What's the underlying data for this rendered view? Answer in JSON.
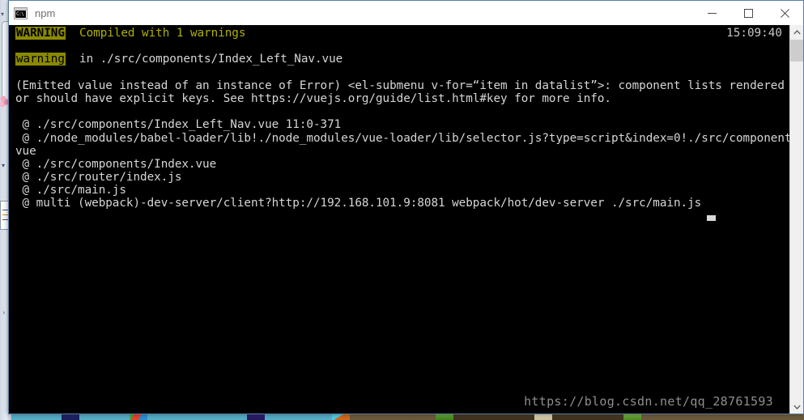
{
  "window": {
    "title": "npm",
    "icon_name": "cmd-console-icon",
    "icon_text": "C:\\",
    "buttons": {
      "minimize": "Minimize",
      "maximize": "Maximize",
      "close": "Close"
    }
  },
  "console": {
    "clock": "15:09:40",
    "cursor": "█",
    "watermark": "https://blog.csdn.net/qq_28761593",
    "lines": [
      {
        "id": "warning-header",
        "tag": "WARNING",
        "tag_style": "upper",
        "text": "  Compiled with 1 warnings",
        "text_color": "yellow"
      },
      {
        "id": "blank-1",
        "text": ""
      },
      {
        "id": "warning-file",
        "tag": "warning",
        "tag_style": "lower",
        "text": "  in ./src/components/Index_Left_Nav.vue",
        "text_color": "white"
      },
      {
        "id": "blank-2",
        "text": ""
      },
      {
        "id": "emitted-value-1",
        "text": "(Emitted value instead of an instance of Error) <el-submenu v-for=“item in datalist”>: component lists rendered with v-f",
        "text_color": "white"
      },
      {
        "id": "emitted-value-2",
        "text": "or should have explicit keys. See https://vuejs.org/guide/list.html#key for more info.",
        "text_color": "white"
      },
      {
        "id": "blank-3",
        "text": ""
      },
      {
        "id": "module-1",
        "text": " @ ./src/components/Index_Left_Nav.vue 11:0-371",
        "text_color": "white"
      },
      {
        "id": "module-2",
        "text": " @ ./node_modules/babel-loader/lib!./node_modules/vue-loader/lib/selector.js?type=script&index=0!./src/components/Index.",
        "text_color": "white"
      },
      {
        "id": "module-2-wrap",
        "text": "vue",
        "text_color": "white"
      },
      {
        "id": "module-3",
        "text": " @ ./src/components/Index.vue",
        "text_color": "white"
      },
      {
        "id": "module-4",
        "text": " @ ./src/router/index.js",
        "text_color": "white"
      },
      {
        "id": "module-5",
        "text": " @ ./src/main.js",
        "text_color": "white"
      },
      {
        "id": "module-6",
        "text": " @ multi (webpack)-dev-server/client?http://192.168.101.9:8081 webpack/hot/dev-server ./src/main.js",
        "text_color": "white"
      }
    ]
  },
  "scrollbar": {
    "up_arrow": "⌃",
    "down_arrow": "⌄"
  },
  "colors": {
    "console_bg": "#000000",
    "tag_bg": "#8a8a00",
    "tag_fg": "#000000",
    "yellow_text": "#b0b000",
    "white_text": "#d6d6d6",
    "titlebar_bg": "#ffffff",
    "window_border": "#5a7fa5"
  }
}
